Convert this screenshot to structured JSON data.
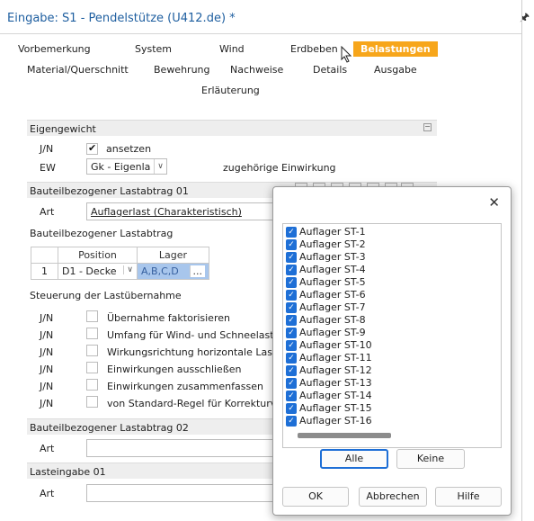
{
  "window": {
    "title": "Eingabe: S1 - Pendelstütze (U412.de) *",
    "pin_icon": "pin-icon"
  },
  "tabs": {
    "vorbemerkung": "Vorbemerkung",
    "system": "System",
    "wind": "Wind",
    "erdbeben": "Erdbeben",
    "belastungen": "Belastungen",
    "material": "Material/Querschnitt",
    "bewehrung": "Bewehrung",
    "nachweise": "Nachweise",
    "details": "Details",
    "ausgabe": "Ausgabe",
    "erlaeuterung": "Erläuterung",
    "active_color": "#f7a61b"
  },
  "eigengewicht": {
    "header": "Eigengewicht",
    "jn_label": "J/N",
    "ansetzen_label": "ansetzen",
    "ansetzen_checked": true,
    "ew_label": "EW",
    "ew_value": "Gk - Eigenla",
    "einwirkung_label": "zugehörige Einwirkung"
  },
  "lastabtrag01": {
    "header": "Bauteilbezogener Lastabtrag 01",
    "art_label": "Art",
    "art_value": "Auflagerlast (Charakteristisch)"
  },
  "lastabtrag_table": {
    "header": "Bauteilbezogener Lastabtrag",
    "col_position": "Position",
    "col_lager": "Lager",
    "row_num": "1",
    "row_position": "D1 - Decke",
    "row_lager": "A,B,C,D",
    "row_more": "..."
  },
  "steuerung": {
    "header": "Steuerung der Lastübernahme",
    "items": [
      {
        "jn": "J/N",
        "label": "Übernahme faktorisieren"
      },
      {
        "jn": "J/N",
        "label": "Umfang für Wind- und Schneelaste"
      },
      {
        "jn": "J/N",
        "label": "Wirkungsrichtung horizontale Laste"
      },
      {
        "jn": "J/N",
        "label": "Einwirkungen ausschließen"
      },
      {
        "jn": "J/N",
        "label": "Einwirkungen zusammenfassen"
      },
      {
        "jn": "J/N",
        "label": "von Standard-Regel für Korrekturve"
      }
    ]
  },
  "lastabtrag02": {
    "header": "Bauteilbezogener Lastabtrag 02",
    "art_label": "Art"
  },
  "lasteingabe01": {
    "header": "Lasteingabe 01",
    "art_label": "Art"
  },
  "dialog": {
    "close_label": "✕",
    "items": [
      "Auflager ST-1",
      "Auflager ST-2",
      "Auflager ST-3",
      "Auflager ST-4",
      "Auflager ST-5",
      "Auflager ST-6",
      "Auflager ST-7",
      "Auflager ST-8",
      "Auflager ST-9",
      "Auflager ST-10",
      "Auflager ST-11",
      "Auflager ST-12",
      "Auflager ST-13",
      "Auflager ST-14",
      "Auflager ST-15",
      "Auflager ST-16"
    ],
    "all_label": "Alle",
    "none_label": "Keine",
    "ok_label": "OK",
    "cancel_label": "Abbrechen",
    "help_label": "Hilfe",
    "check_color": "#1e6fd6"
  }
}
